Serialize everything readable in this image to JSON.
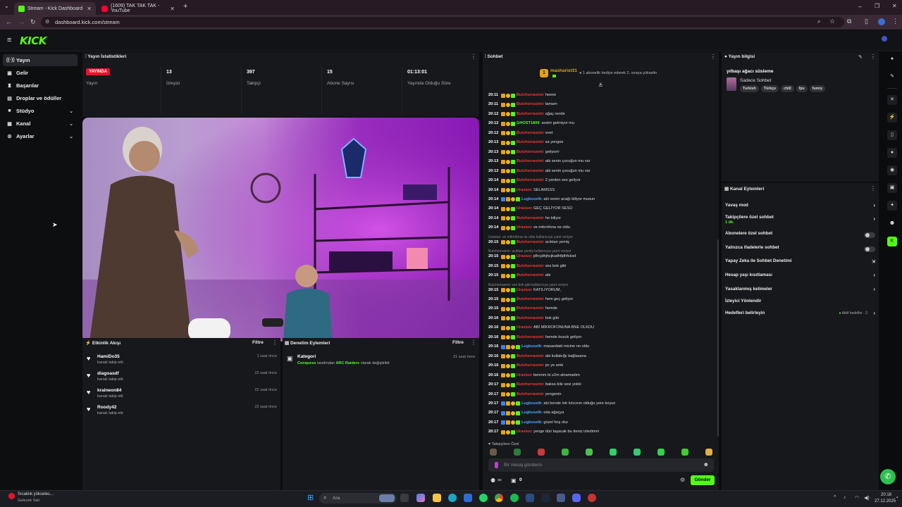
{
  "browser": {
    "tabs": [
      {
        "title": "Stream - Kick Dashboard",
        "favicon_color": "#53fc18"
      },
      {
        "title": "(1609) TAK TAK TAK - YouTube",
        "favicon_color": "#ff0033"
      }
    ],
    "url": "dashboard.kick.com/stream"
  },
  "header": {
    "logo": "KICK"
  },
  "sidebar": {
    "items": [
      {
        "label": "Yayın",
        "icon": "broadcast-icon"
      },
      {
        "label": "Gelir",
        "icon": "wallet-icon"
      },
      {
        "label": "Başarılar",
        "icon": "trophy-icon"
      },
      {
        "label": "Droplar ve ödüller",
        "icon": "gift-icon"
      },
      {
        "label": "Stüdyo",
        "icon": "studio-icon"
      },
      {
        "label": "Kanal",
        "icon": "channel-icon"
      },
      {
        "label": "Ayarlar",
        "icon": "gear-icon"
      }
    ]
  },
  "stats": {
    "title": "Yayın İstatistikleri",
    "live_badge": "YAYINDA",
    "live_label": "Yayın",
    "viewers_value": "13",
    "viewers_label": "İzleyici",
    "followers_value": "397",
    "followers_label": "Takipçi",
    "subs_value": "15",
    "subs_label": "Abone Sayısı",
    "duration_value": "01:13:01",
    "duration_label": "Yayında Olduğu Süre"
  },
  "activity": {
    "title": "Etkinlik Akışı",
    "filter": "Filtre",
    "items": [
      {
        "name": "HamiDo35",
        "sub": "kanalı takip etti",
        "time": "1 saat önce"
      },
      {
        "name": "diagoasdf",
        "sub": "kanalı takip etti",
        "time": "22 saat önce"
      },
      {
        "name": "kralneon84",
        "sub": "kanalı takip etti",
        "time": "22 saat önce"
      },
      {
        "name": "Roody42",
        "sub": "kanalı takip etti",
        "time": "22 saat önce"
      }
    ]
  },
  "moderation": {
    "title": "Denetim Eylemleri",
    "filter": "Filtre",
    "item_title": "Kategori",
    "item_user": "Conquess",
    "item_mid": "tarafından",
    "item_target": "ARC Raiders",
    "item_end": "olarak değiştirildi",
    "item_time": "21 saat önce"
  },
  "chat": {
    "title": "Sohbet",
    "pinned_user": "masharist31",
    "pinned_text": "1 abonelik hediye ederek 2. sıraya yükselin",
    "messages": [
      {
        "time": "20:11",
        "user": "Butcherrasimi",
        "color": "#e63b3b",
        "text": "heeee",
        "reply": ""
      },
      {
        "time": "20:11",
        "user": "Butcherrasimi",
        "color": "#e63b3b",
        "text": "tamam",
        "reply": ""
      },
      {
        "time": "20:12",
        "user": "Butcherrasimi",
        "color": "#e63b3b",
        "text": "ağaç nerde",
        "reply": ""
      },
      {
        "time": "20:12",
        "user": "GHOST1809",
        "color": "#53fc18",
        "text": "sesim gelmiyor mu",
        "reply": ""
      },
      {
        "time": "20:12",
        "user": "Butcherrasimi",
        "color": "#e63b3b",
        "text": "evet",
        "reply": ""
      },
      {
        "time": "20:13",
        "user": "Butcherrasimi",
        "color": "#e63b3b",
        "text": "sa yengee",
        "reply": ""
      },
      {
        "time": "20:13",
        "user": "Butcherrasimi",
        "color": "#e63b3b",
        "text": "geliyorrr",
        "reply": ""
      },
      {
        "time": "20:13",
        "user": "Butcherrasimi",
        "color": "#e63b3b",
        "text": "abi senin çocuğun mu var",
        "reply": ""
      },
      {
        "time": "20:13",
        "user": "Butcherrasimi",
        "color": "#e63b3b",
        "text": "abi senin çocuğun mu var",
        "reply": ""
      },
      {
        "time": "20:14",
        "user": "Butcherrasimi",
        "color": "#e63b3b",
        "text": "2 yerden ses geliyor",
        "reply": ""
      },
      {
        "time": "20:14",
        "user": "Urasiuo",
        "color": "#e63b3b",
        "text": "SELAMSSS",
        "reply": ""
      },
      {
        "time": "20:14",
        "user": "Lugbuselb",
        "color": "#4aa3ff",
        "text": "abi veren acağı biliyor musun",
        "reply": ""
      },
      {
        "time": "20:14",
        "user": "Urasiuo",
        "color": "#e63b3b",
        "text": "GEÇ GELİYOR SESÜ",
        "reply": ""
      },
      {
        "time": "20:14",
        "user": "Butcherrasimi",
        "color": "#e63b3b",
        "text": "he biliyor",
        "reply": ""
      },
      {
        "time": "20:14",
        "user": "Urasiuo",
        "color": "#e63b3b",
        "text": "ve mikrofona ne oldu",
        "reply": ""
      },
      {
        "time": "20:15",
        "user": "Butcherrasimi",
        "color": "#e63b3b",
        "text": "acıktan yemiş",
        "reply": "Urasiuo: ve mikrofona ne oldu kullanıcıya yanıt veriyor"
      },
      {
        "time": "20:15",
        "user": "Urasiuo",
        "color": "#e63b3b",
        "text": "jdhcjdhjhcjkadhfjdhfcksd",
        "reply": "Butcherrasimi: acıktan yemiş kullanıcıya yanıt veriyor"
      },
      {
        "time": "20:15",
        "user": "Butcherrasimi",
        "color": "#e63b3b",
        "text": "ses bok gibi",
        "reply": ""
      },
      {
        "time": "20:15",
        "user": "Butcherrasimi",
        "color": "#e63b3b",
        "text": "abi",
        "reply": ""
      },
      {
        "time": "20:15",
        "user": "Urasiuo",
        "color": "#e63b3b",
        "text": "KATILIYORUM,",
        "reply": "Butcherrasimi: ses bok gibi kullanıcıya yanıt veriyor"
      },
      {
        "time": "20:15",
        "user": "Butcherrasimi",
        "color": "#e63b3b",
        "text": "hem geç geliyor",
        "reply": ""
      },
      {
        "time": "20:15",
        "user": "Butcherrasimi",
        "color": "#e63b3b",
        "text": "hemde",
        "reply": ""
      },
      {
        "time": "20:16",
        "user": "Butcherrasimi",
        "color": "#e63b3b",
        "text": "bok gibi",
        "reply": ""
      },
      {
        "time": "20:16",
        "user": "Urasiuo",
        "color": "#e63b3b",
        "text": "ABİ MİKROFONUNA BNE OLKDU",
        "reply": ""
      },
      {
        "time": "20:16",
        "user": "Butcherrasimi",
        "color": "#e63b3b",
        "text": "hemde bozuk geliyor",
        "reply": ""
      },
      {
        "time": "20:16",
        "user": "Lugbuselb",
        "color": "#4aa3ff",
        "text": "masandaki micine no oldu",
        "reply": ""
      },
      {
        "time": "20:16",
        "user": "Butcherrasimi",
        "color": "#e63b3b",
        "text": "abi kullakılğı bağlasana",
        "reply": ""
      },
      {
        "time": "20:16",
        "user": "Butcherrasimi",
        "color": "#e63b3b",
        "text": "pc ye amk",
        "reply": ""
      },
      {
        "time": "20:16",
        "user": "Urasiuo",
        "color": "#e63b3b",
        "text": "benmm bi s2m alnamadım",
        "reply": ""
      },
      {
        "time": "20:17",
        "user": "Butcherrasimi",
        "color": "#e63b3b",
        "text": "baksa bile sesi yokki",
        "reply": ""
      },
      {
        "time": "20:17",
        "user": "Butcherrasimi",
        "color": "#e63b3b",
        "text": "yengenin",
        "reply": ""
      },
      {
        "time": "20:17",
        "user": "Lugbuselb",
        "color": "#4aa3ff",
        "text": "abi bende lotr kılıcının olduğu yere koyun",
        "reply": ""
      },
      {
        "time": "20:17",
        "user": "Lugbuselb",
        "color": "#4aa3ff",
        "text": "oda ağaçya",
        "reply": ""
      },
      {
        "time": "20:17",
        "user": "Lugbuselb",
        "color": "#4aa3ff",
        "text": "güzel hoş olur",
        "reply": ""
      },
      {
        "time": "20:17",
        "user": "Urasiuo",
        "color": "#e63b3b",
        "text": "yenge dün taşacak bu deniz izledinmi",
        "reply": ""
      }
    ],
    "followers_only": "Takipçilere Özel",
    "input_placeholder": "Bir mesaj gönderin",
    "infinity": "∞",
    "gift_count": "0",
    "send_label": "Gönder"
  },
  "stream_info": {
    "title": "Yayın bilgisi",
    "stream_title": "yılbaşı ağacı süsleme",
    "category": "Sadece Sohbet",
    "tags": [
      "Turkish",
      "Türkçe",
      "chill",
      "fps",
      "funny"
    ]
  },
  "channel_actions": {
    "title": "Kanal Eylemleri",
    "items": [
      {
        "label": "Yavaş mod",
        "sub": "",
        "kind": "arrow"
      },
      {
        "label": "Takipçilere özel sohbet",
        "sub": "1 dk.",
        "kind": "arrow"
      },
      {
        "label": "Abonelere özel sohbet",
        "sub": "",
        "kind": "toggle"
      },
      {
        "label": "Yalnızca ifadelerle sohbet",
        "sub": "",
        "kind": "toggle"
      },
      {
        "label": "Yapay Zeka ile Sohbet Denetimi",
        "sub": "",
        "kind": "external"
      },
      {
        "label": "Hesap yaşı kısıtlaması",
        "sub": "",
        "kind": "arrow"
      },
      {
        "label": "Yasaklanmış kelimeler",
        "sub": "",
        "kind": "arrow"
      },
      {
        "label": "İzleyici Yönlendir",
        "sub": "",
        "kind": "none"
      },
      {
        "label": "Hedefleri belirleyin",
        "sub": "",
        "kind": "goal"
      }
    ],
    "goal_status": "Aktif hedefler · 2"
  },
  "taskbar": {
    "weather_title": "Sıcaklık yükselec...",
    "weather_sub": "Gelecek Salı",
    "search_placeholder": "Ara",
    "time": "20:18",
    "date": "27.12.2025"
  },
  "colors": {
    "accent": "#53fc18",
    "live": "#e9112b",
    "panel": "#17181b"
  }
}
